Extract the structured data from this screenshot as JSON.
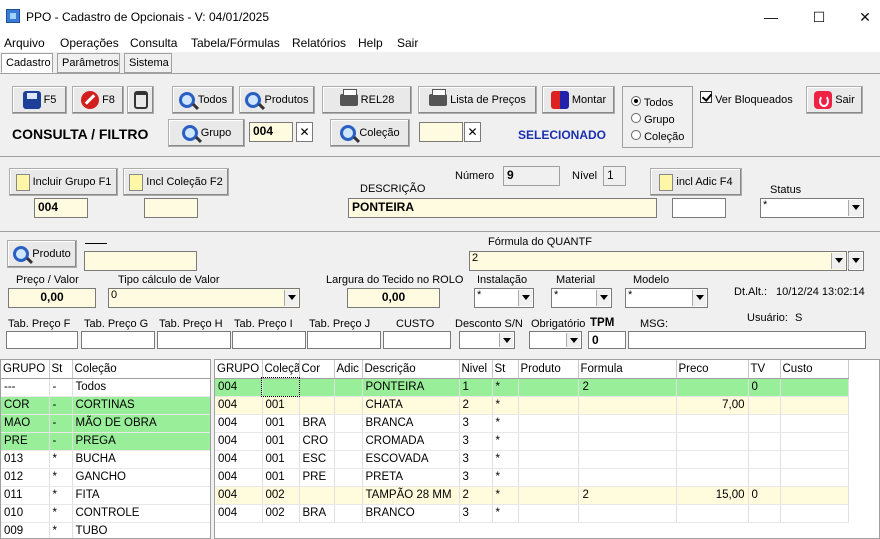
{
  "window": {
    "title": "PPO - Cadastro de Opcionais - V: 04/01/2025"
  },
  "menu": [
    "Arquivo",
    "Operações",
    "Consulta",
    "Tabela/Fórmulas",
    "Relatórios",
    "Help",
    "Sair"
  ],
  "tabs": [
    "Cadastro",
    "Parâmetros",
    "Sistema"
  ],
  "toolbar": {
    "f5": "F5",
    "f8": "F8",
    "todos": "Todos",
    "produtos": "Produtos",
    "rel28": "REL28",
    "lista_precos": "Lista de Preços",
    "montar": "Montar",
    "ver_bloqueados": "Ver Bloqueados",
    "sair": "Sair"
  },
  "filter": {
    "title": "CONSULTA / FILTRO",
    "grupo_label": "Grupo",
    "grupo_value": "004",
    "colecao_label": "Coleção",
    "colecao_value": "",
    "selecionado": "SELECIONADO",
    "radios": [
      "Todos",
      "Grupo",
      "Coleção"
    ]
  },
  "form": {
    "incluir_grupo": "Incluir Grupo F1",
    "incl_colecao": "Incl Coleção F2",
    "incl_adic": "incl Adic F4",
    "grupo_value": "004",
    "colecao_value": "",
    "numero_label": "Número",
    "numero_value": "9",
    "nivel_label": "Nível",
    "nivel_value": "1",
    "descricao_label": "DESCRIÇÃO",
    "descricao_value": "PONTEIRA",
    "adic_value": "",
    "status_label": "Status",
    "status_value": "*",
    "produto_button": "Produto",
    "produto_value": "",
    "formula_label": "Fórmula do QUANTF",
    "formula_value": "2",
    "preco_valor_label": "Preço / Valor",
    "preco_valor_value": "0,00",
    "tipo_calculo_label": "Tipo cálculo de Valor",
    "tipo_calculo_value": "0",
    "largura_label": "Largura do Tecido no ROLO",
    "largura_value": "0,00",
    "instalacao_label": "Instalação",
    "instalacao_value": "*",
    "material_label": "Material",
    "material_value": "*",
    "modelo_label": "Modelo",
    "modelo_value": "*",
    "dtalt_label": "Dt.Alt.:",
    "dtalt_value": "10/12/24  13:02:14",
    "usuario_label": "Usuário:",
    "usuario_value": "S",
    "tab_preco_f": "Tab. Preço F",
    "tab_preco_g": "Tab. Preço G",
    "tab_preco_h": "Tab. Preço H",
    "tab_preco_i": "Tab. Preço I",
    "tab_preco_j": "Tab. Preço J",
    "custo": "CUSTO",
    "desconto": "Desconto S/N",
    "obrigatorio": "Obrigatório",
    "tpm_label": "TPM",
    "tpm_value": "0",
    "msg_label": "MSG:"
  },
  "left_grid": {
    "headers": [
      "GRUPO",
      "St",
      "Coleção"
    ],
    "rows": [
      {
        "grupo": "---",
        "st": "-",
        "colecao": "Todos",
        "hl": ""
      },
      {
        "grupo": "COR",
        "st": "-",
        "colecao": "CORTINAS",
        "hl": "green"
      },
      {
        "grupo": "MAO",
        "st": "-",
        "colecao": "MÃO DE OBRA",
        "hl": "green"
      },
      {
        "grupo": "PRE",
        "st": "-",
        "colecao": "PREGA",
        "hl": "green"
      },
      {
        "grupo": "013",
        "st": "*",
        "colecao": "BUCHA",
        "hl": ""
      },
      {
        "grupo": "012",
        "st": "*",
        "colecao": "GANCHO",
        "hl": ""
      },
      {
        "grupo": "011",
        "st": "*",
        "colecao": "FITA",
        "hl": ""
      },
      {
        "grupo": "010",
        "st": "*",
        "colecao": "CONTROLE",
        "hl": ""
      },
      {
        "grupo": "009",
        "st": "*",
        "colecao": "TUBO",
        "hl": ""
      }
    ]
  },
  "right_grid": {
    "headers": [
      "GRUPO",
      "Coleçã",
      "Cor",
      "Adic",
      "Descrição",
      "Nivel",
      "St",
      "Produto",
      "Formula",
      "Preco",
      "TV",
      "Custo"
    ],
    "rows": [
      {
        "grupo": "004",
        "colecao": "",
        "cor": "",
        "adic": "",
        "descricao": "PONTEIRA",
        "nivel": "1",
        "st": "*",
        "produto": "",
        "formula": "2",
        "preco": "",
        "tv": "0",
        "custo": "",
        "hl": "green"
      },
      {
        "grupo": "004",
        "colecao": "001",
        "cor": "",
        "adic": "",
        "descricao": "CHATA",
        "nivel": "2",
        "st": "*",
        "produto": "",
        "formula": "",
        "preco": "7,00",
        "tv": "",
        "custo": "",
        "hl": "yellow"
      },
      {
        "grupo": "004",
        "colecao": "001",
        "cor": "BRA",
        "adic": "",
        "descricao": "BRANCA",
        "nivel": "3",
        "st": "*",
        "produto": "",
        "formula": "",
        "preco": "",
        "tv": "",
        "custo": "",
        "hl": ""
      },
      {
        "grupo": "004",
        "colecao": "001",
        "cor": "CRO",
        "adic": "",
        "descricao": "CROMADA",
        "nivel": "3",
        "st": "*",
        "produto": "",
        "formula": "",
        "preco": "",
        "tv": "",
        "custo": "",
        "hl": ""
      },
      {
        "grupo": "004",
        "colecao": "001",
        "cor": "ESC",
        "adic": "",
        "descricao": "ESCOVADA",
        "nivel": "3",
        "st": "*",
        "produto": "",
        "formula": "",
        "preco": "",
        "tv": "",
        "custo": "",
        "hl": ""
      },
      {
        "grupo": "004",
        "colecao": "001",
        "cor": "PRE",
        "adic": "",
        "descricao": "PRETA",
        "nivel": "3",
        "st": "*",
        "produto": "",
        "formula": "",
        "preco": "",
        "tv": "",
        "custo": "",
        "hl": ""
      },
      {
        "grupo": "004",
        "colecao": "002",
        "cor": "",
        "adic": "",
        "descricao": "TAMPÃO 28 MM",
        "nivel": "2",
        "st": "*",
        "produto": "",
        "formula": "2",
        "preco": "15,00",
        "tv": "0",
        "custo": "",
        "hl": "yellow"
      },
      {
        "grupo": "004",
        "colecao": "002",
        "cor": "BRA",
        "adic": "",
        "descricao": "BRANCO",
        "nivel": "3",
        "st": "*",
        "produto": "",
        "formula": "",
        "preco": "",
        "tv": "",
        "custo": "",
        "hl": ""
      }
    ]
  }
}
